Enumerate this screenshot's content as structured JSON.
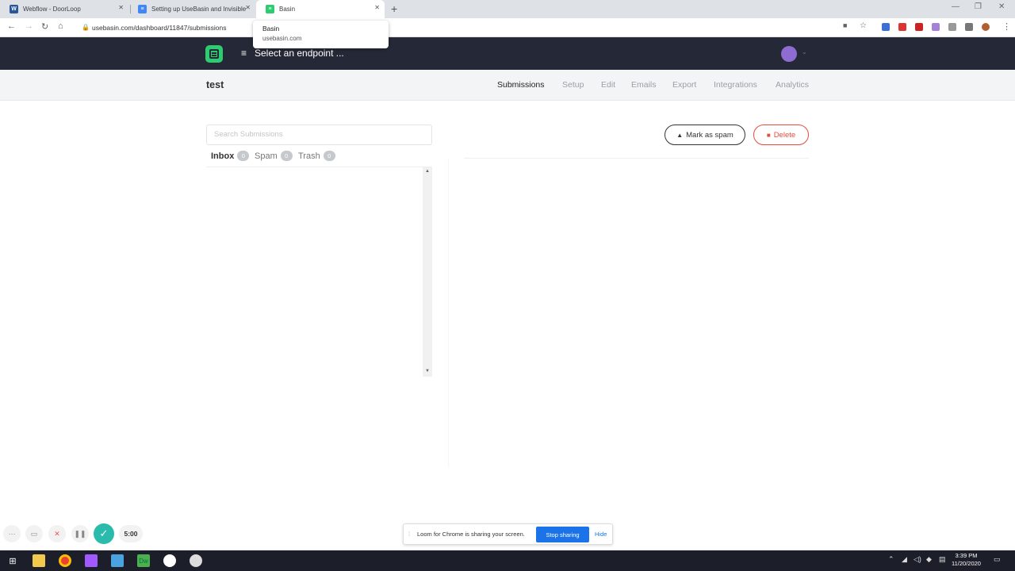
{
  "browser": {
    "tabs": [
      {
        "title": "Webflow - DoorLoop",
        "icon": "word-icon",
        "color": "#2b579a"
      },
      {
        "title": "Setting up UseBasin and Invisible",
        "icon": "docs-icon",
        "color": "#4285f4"
      },
      {
        "title": "Basin",
        "icon": "basin-icon",
        "color": "#2ecc71"
      }
    ],
    "url": "usebasin.com/dashboard/11847/submissions",
    "tooltip": {
      "title": "Basin",
      "domain": "usebasin.com"
    }
  },
  "app": {
    "endpoint_label": "Select an endpoint ...",
    "form_name": "test",
    "nav": [
      {
        "label": "Submissions",
        "active": true
      },
      {
        "label": "Setup"
      },
      {
        "label": "Edit"
      },
      {
        "label": "Emails"
      },
      {
        "label": "Export"
      },
      {
        "label": "Integrations"
      },
      {
        "label": "Analytics"
      }
    ],
    "search_placeholder": "Search Submissions",
    "folders": [
      {
        "label": "Inbox",
        "count": "0"
      },
      {
        "label": "Spam",
        "count": "0"
      },
      {
        "label": "Trash",
        "count": "0"
      }
    ],
    "mark_spam_label": "Mark as spam",
    "delete_label": "Delete",
    "brand_color": "#2ecc71",
    "danger_color": "#e74c3c"
  },
  "loom": {
    "timer": "5:00",
    "share_text": "Loom for Chrome is sharing your screen.",
    "stop_label": "Stop sharing",
    "hide_label": "Hide"
  },
  "taskbar": {
    "time": "3:39 PM",
    "date": "11/20/2020"
  }
}
